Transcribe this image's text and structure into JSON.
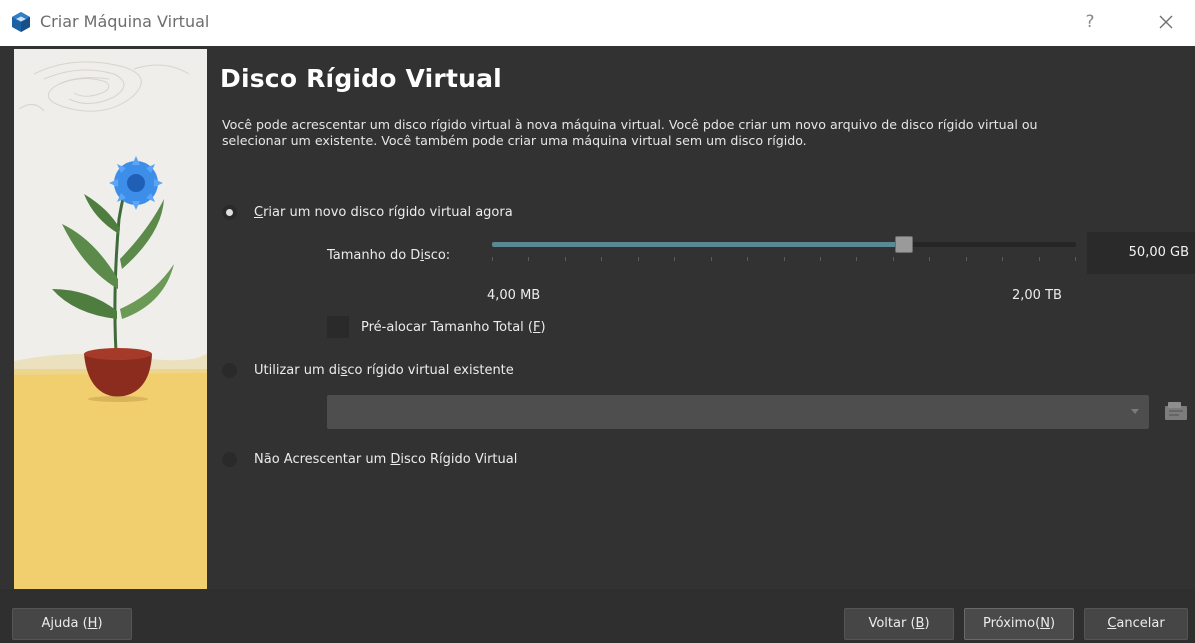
{
  "window": {
    "title": "Criar Máquina Virtual",
    "help_label": "?",
    "icons": {
      "app": "virtualbox-cube-icon",
      "close": "close-icon"
    }
  },
  "page": {
    "heading": "Disco Rígido Virtual",
    "description": "Você pode acrescentar um disco rígido virtual à nova máquina virtual. Você pdoe criar um novo arquivo de disco rígido virtual ou selecionar um existente. Você também pode criar uma máquina virtual sem um disco rígido."
  },
  "options": {
    "create_new": {
      "pre": "",
      "mnemonic": "C",
      "post": "riar um novo disco rígido virtual agora",
      "selected": true
    },
    "use_existing": {
      "pre": "Utilizar um di",
      "mnemonic": "s",
      "post": "co rígido virtual existente",
      "selected": false
    },
    "none": {
      "pre": "Não Acrescentar um ",
      "mnemonic": "D",
      "post": "isco Rígido Virtual",
      "selected": false
    }
  },
  "disk_size": {
    "label_pre": "Tamanho do D",
    "label_mnemonic": "i",
    "label_post": "sco:",
    "value": "50,00 GB",
    "min_label": "4,00 MB",
    "max_label": "2,00 TB",
    "slider_fraction": 0.705
  },
  "preallocate": {
    "label_pre": "Pré-alocar Tamanho Total (",
    "label_mnemonic": "F",
    "label_post": ")",
    "checked": false
  },
  "existing_disk": {
    "selected_value": "",
    "folder_icon": "choose-disk-file-icon"
  },
  "buttons": {
    "help": {
      "pre": "Ajuda (",
      "mnemonic": "H",
      "post": ")"
    },
    "back": {
      "pre": "Voltar (",
      "mnemonic": "B",
      "post": ")"
    },
    "next": {
      "pre": "Próximo(",
      "mnemonic": "N",
      "post": ")"
    },
    "cancel": {
      "pre": "",
      "mnemonic": "C",
      "post": "ancelar"
    }
  },
  "colors": {
    "background": "#323232",
    "slider_fill": "#5a8894",
    "illustration_floor": "#f2cf6e"
  }
}
